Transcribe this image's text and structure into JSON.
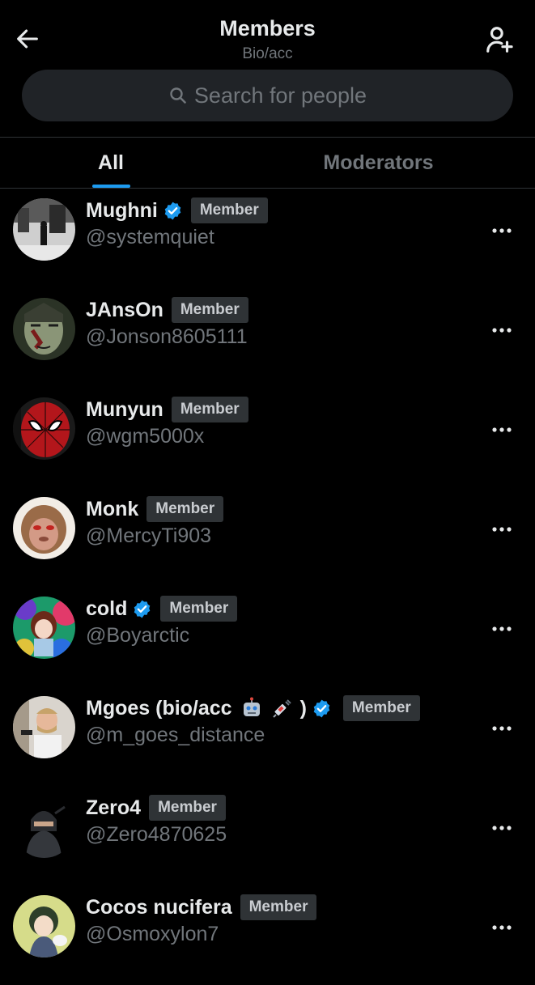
{
  "header": {
    "title": "Members",
    "subtitle": "Bio/acc",
    "back_icon": "arrow-left-icon",
    "add_icon": "add-person-icon"
  },
  "search": {
    "placeholder": "Search for people",
    "icon": "search-icon"
  },
  "tabs": [
    {
      "label": "All",
      "active": true
    },
    {
      "label": "Moderators",
      "active": false
    }
  ],
  "colors": {
    "accent": "#1d9bf0",
    "background": "#000000",
    "muted": "#71767b",
    "badge_bg": "#2f3336"
  },
  "members": [
    {
      "name": "Mughni",
      "verified": true,
      "role": "Member",
      "handle": "@systemquiet"
    },
    {
      "name": "JAnsOn",
      "verified": false,
      "role": "Member",
      "handle": "@Jonson8605111"
    },
    {
      "name": "Munyun",
      "verified": false,
      "role": "Member",
      "handle": "@wgm5000x"
    },
    {
      "name": "Monk",
      "verified": false,
      "role": "Member",
      "handle": "@MercyTi903"
    },
    {
      "name": "cold",
      "verified": true,
      "role": "Member",
      "handle": "@Boyarctic"
    },
    {
      "name": "Mgoes (bio/acc",
      "name_suffix": ")",
      "emojis": [
        "robot-emoji",
        "syringe-emoji"
      ],
      "verified": true,
      "role": "Member",
      "handle": "@m_goes_distance"
    },
    {
      "name": "Zero4",
      "verified": false,
      "role": "Member",
      "handle": "@Zero4870625"
    },
    {
      "name": "Cocos nucifera",
      "verified": false,
      "role": "Member",
      "handle": "@Osmoxylon7"
    }
  ],
  "row_action_icon": "more-horizontal-icon"
}
